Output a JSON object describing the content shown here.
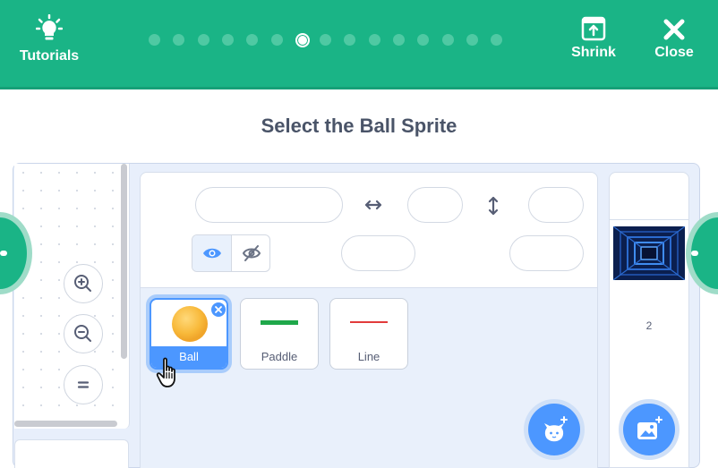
{
  "header": {
    "tutorials_label": "Tutorials",
    "shrink_label": "Shrink",
    "close_label": "Close",
    "progress": {
      "total_steps": 15,
      "current_step": 7
    }
  },
  "title": "Select the Ball Sprite",
  "sprites": [
    {
      "name": "Ball",
      "selected": true
    },
    {
      "name": "Paddle",
      "selected": false
    },
    {
      "name": "Line",
      "selected": false
    }
  ],
  "stage_panel": {
    "backdrop_count": "2"
  },
  "icons": {
    "tutorials": "lightbulb-icon",
    "shrink": "shrink-window-icon",
    "close": "close-x-icon",
    "show": "eye-icon",
    "hide": "eye-slash-icon",
    "zoom_in": "zoom-in-icon",
    "zoom_out": "zoom-out-icon",
    "zoom_reset": "equals-icon",
    "choose_sprite": "cat-plus-icon",
    "choose_backdrop": "image-plus-icon"
  },
  "colors": {
    "header": "#1ab486",
    "accent": "#4c97ff",
    "paddle": "#1fa84a",
    "line": "#e23b3b"
  }
}
